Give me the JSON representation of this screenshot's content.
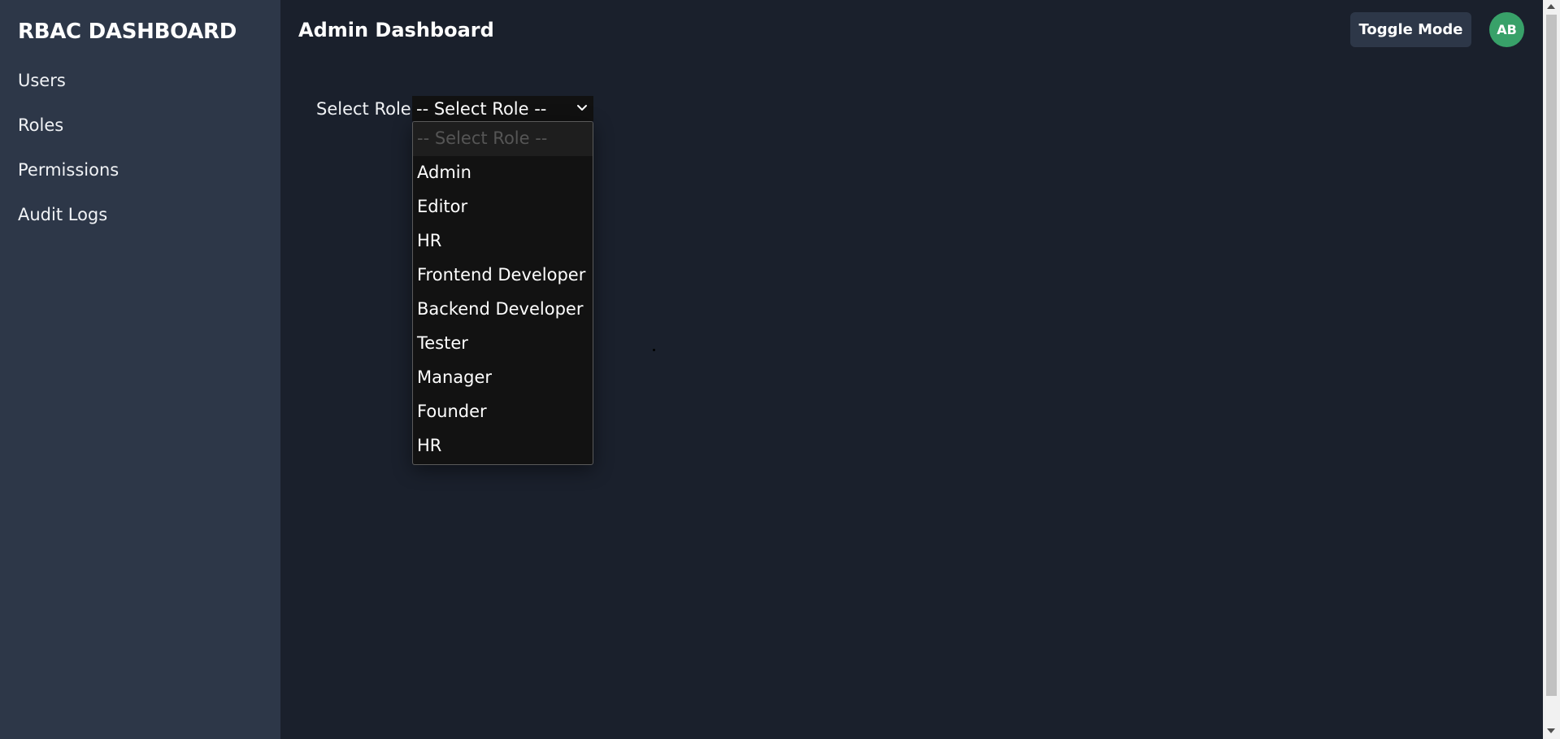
{
  "sidebar": {
    "brand": "RBAC DASHBOARD",
    "items": [
      {
        "label": "Users"
      },
      {
        "label": "Roles"
      },
      {
        "label": "Permissions"
      },
      {
        "label": "Audit Logs"
      }
    ]
  },
  "header": {
    "title": "Admin Dashboard",
    "toggle_label": "Toggle Mode",
    "avatar_initials": "AB"
  },
  "role_select": {
    "label": "Select Role:",
    "selected": "-- Select Role --",
    "options": [
      "-- Select Role --",
      "Admin",
      "Editor",
      "HR",
      "Frontend Developer",
      "Backend Developer",
      "Tester",
      "Manager",
      "Founder",
      "HR"
    ]
  },
  "colors": {
    "sidebar_bg": "#2d3748",
    "main_bg": "#1a202c",
    "avatar_bg": "#38a169",
    "dropdown_bg": "#121212"
  },
  "icons": {
    "select_chevron": "chevron-down-icon"
  }
}
